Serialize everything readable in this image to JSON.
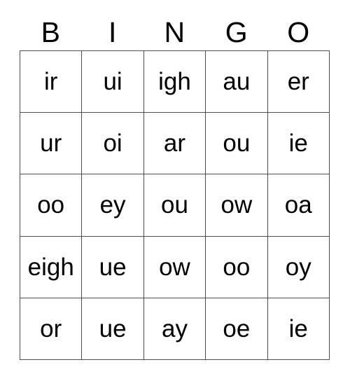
{
  "card": {
    "title": "BINGO",
    "columns": [
      "B",
      "I",
      "N",
      "G",
      "O"
    ],
    "rows": [
      [
        "ir",
        "ui",
        "igh",
        "au",
        "er"
      ],
      [
        "ur",
        "oi",
        "ar",
        "ou",
        "ie"
      ],
      [
        "oo",
        "ey",
        "ou",
        "ow",
        "oa"
      ],
      [
        "eigh",
        "ue",
        "ow",
        "oo",
        "oy"
      ],
      [
        "or",
        "ue",
        "ay",
        "oe",
        "ie"
      ]
    ],
    "colors": {
      "background": "#ffffff",
      "text": "#000000",
      "grid_line": "#4d4d4d"
    }
  }
}
